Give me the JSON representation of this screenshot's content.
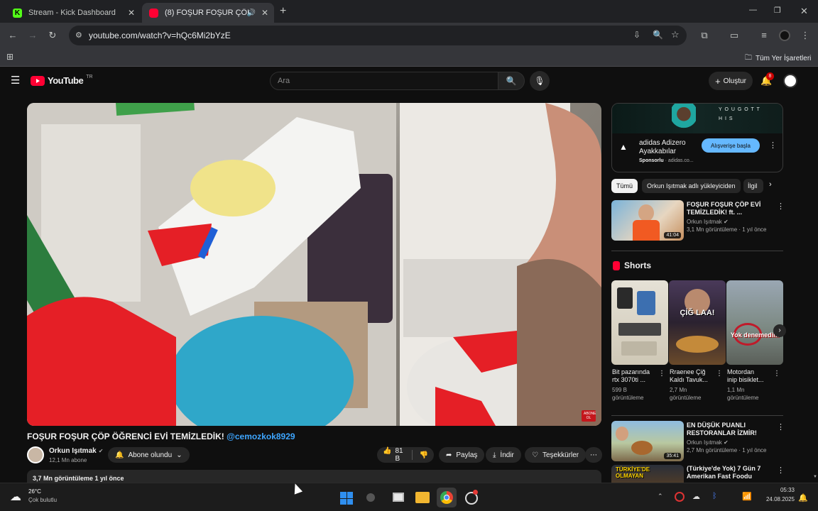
{
  "tabs": [
    {
      "title": "Stream - Kick Dashboard",
      "favicon_color": "#53fc18",
      "favicon_letter": "K"
    },
    {
      "title": "(8) FOŞUR FOŞUR ÇÖP ÖĞR",
      "favicon_color": "#ff0033",
      "favicon_letter": ""
    }
  ],
  "window_controls": {
    "minimize": "—",
    "maximize": "❐",
    "close": "✕"
  },
  "new_tab": "+",
  "address": "youtube.com/watch?v=hQc6Mi2bYzE",
  "bookmarks": {
    "all_label": "Tüm Yer İşaretleri"
  },
  "yt": {
    "logo_text": "YouTube",
    "region": "TR",
    "search_placeholder": "Ara",
    "create_label": "Oluştur",
    "notif_count": "8"
  },
  "video": {
    "title": "FOŞUR FOŞUR ÇÖP ÖĞRENCİ EVİ TEMİZLEDİK!",
    "mention": "@cemozkok8929",
    "channel": "Orkun Işıtmak",
    "subs": "12,1 Mn abone",
    "subscribed_label": "Abone olundu",
    "likes": "81 B",
    "share_label": "Paylaş",
    "download_label": "İndir",
    "thanks_label": "Teşekkürler",
    "desc_meta": "3,7 Mn görüntüleme  1 yıl önce",
    "overlay_badge": "ABONE OL"
  },
  "ad": {
    "banner_text": "Y O U   G O T   T H I S",
    "title_line1": "adidas Adizero",
    "title_line2": "Ayakkabılar",
    "sponsored": "Sponsorlu",
    "domain": "· adidas.co...",
    "cta": "Alışverişe başla"
  },
  "chips": [
    "Tümü",
    "Orkun Işıtmak adlı yükleyiciden",
    "İlgil"
  ],
  "recommended": [
    {
      "title_line1": "FOŞUR FOŞUR ÇÖP EVİ",
      "title_line2": "TEMİZLEDİK! ft. ...",
      "channel": "Orkun Işıtmak",
      "meta": "3,1 Mn görüntüleme · 1 yıl önce",
      "duration": "41:04"
    }
  ],
  "shorts": {
    "header": "Shorts",
    "items": [
      {
        "title_line1": "Bit pazarında",
        "title_line2": "rtx 3070ti ...",
        "views_line1": "599 B",
        "views_line2": "görüntüleme",
        "overlay": ""
      },
      {
        "title_line1": "Rraenee Çiğ",
        "title_line2": "Kaldı Tavuk...",
        "views_line1": "2,7 Mn",
        "views_line2": "görüntüleme",
        "overlay": "ÇİĞ LAA!"
      },
      {
        "title_line1": "Motordan",
        "title_line2": "inip bisiklet...",
        "views_line1": "1,1 Mn",
        "views_line2": "görüntüleme",
        "overlay": "Yok denemedim"
      }
    ]
  },
  "more_videos": [
    {
      "title_line1": "EN DÜŞÜK PUANLI",
      "title_line2": "RESTORANLAR İZMİR!",
      "channel": "Orkun Işıtmak",
      "meta": "2,7 Mn görüntüleme · 1 yıl önce",
      "duration": "35:41",
      "overlay": ""
    },
    {
      "title_line1": "(Türkiye'de Yok) 7 Gün 7",
      "title_line2": "Amerikan Fast Foodu",
      "channel": "",
      "meta": "",
      "duration": "",
      "overlay": "TÜRKİYE'DE OLMAYAN"
    }
  ],
  "taskbar": {
    "weather_temp": "26°C",
    "weather_desc": "Çok bulutlu",
    "time": "05:33",
    "date": "24.08.2025"
  },
  "colors": {
    "yt_red": "#ff0033",
    "link_blue": "#3ea6ff",
    "cta_blue": "#65b8ff"
  }
}
